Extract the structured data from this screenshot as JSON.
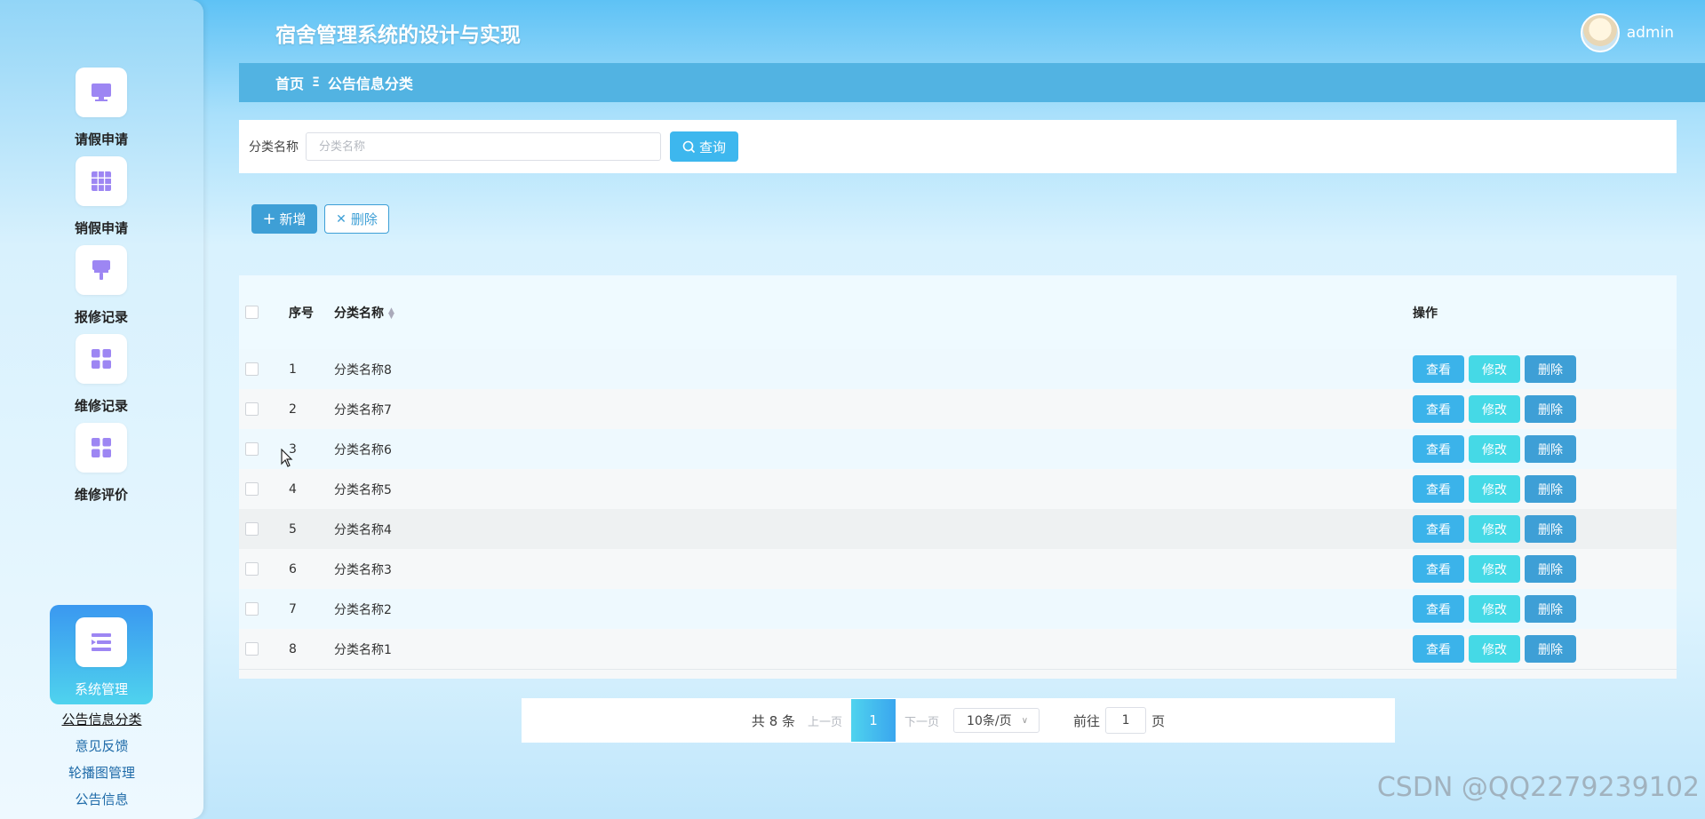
{
  "header": {
    "title": "宿舍管理系统的设计与实现",
    "user": "admin"
  },
  "breadcrumb": {
    "home": "首页",
    "separator": "Ξ",
    "current": "公告信息分类"
  },
  "sidebar": {
    "items": [
      {
        "label": "请假申请",
        "icon": "monitor-icon"
      },
      {
        "label": "销假申请",
        "icon": "grid-icon"
      },
      {
        "label": "报修记录",
        "icon": "brush-icon"
      },
      {
        "label": "维修记录",
        "icon": "apps-icon"
      },
      {
        "label": "维修评价",
        "icon": "apps-icon"
      },
      {
        "label": "系统管理",
        "icon": "list-icon",
        "active": true
      }
    ],
    "sub_items": [
      "公告信息分类",
      "意见反馈",
      "轮播图管理",
      "公告信息"
    ]
  },
  "search": {
    "label": "分类名称",
    "placeholder": "分类名称",
    "button": "查询"
  },
  "actions": {
    "add": "新增",
    "delete": "删除"
  },
  "table": {
    "columns": [
      "序号",
      "分类名称",
      "操作"
    ],
    "rows": [
      {
        "no": "1",
        "name": "分类名称8"
      },
      {
        "no": "2",
        "name": "分类名称7"
      },
      {
        "no": "3",
        "name": "分类名称6"
      },
      {
        "no": "4",
        "name": "分类名称5"
      },
      {
        "no": "5",
        "name": "分类名称4"
      },
      {
        "no": "6",
        "name": "分类名称3"
      },
      {
        "no": "7",
        "name": "分类名称2"
      },
      {
        "no": "8",
        "name": "分类名称1"
      }
    ],
    "row_actions": {
      "view": "查看",
      "edit": "修改",
      "remove": "删除"
    }
  },
  "pagination": {
    "total": "共 8 条",
    "prev": "上一页",
    "current": "1",
    "next": "下一页",
    "page_size": "10条/页",
    "goto_label": "前往",
    "goto_value": "1",
    "page_unit": "页"
  },
  "watermark": "CSDN @QQ2279239102",
  "colors": {
    "accent": "#3db7ee",
    "breadcrumb_bg": "#52b3e2",
    "edit_button": "#45d9e6",
    "delete_button": "#3e9fd6"
  }
}
